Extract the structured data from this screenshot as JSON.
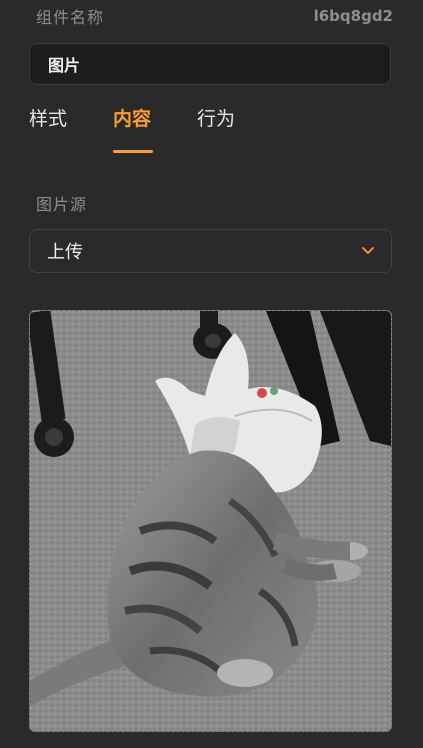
{
  "header": {
    "label": "组件名称",
    "component_id": "l6bq8gd2"
  },
  "name_field": {
    "value": "图片"
  },
  "tabs": [
    {
      "label": "样式",
      "active": false
    },
    {
      "label": "内容",
      "active": true
    },
    {
      "label": "行为",
      "active": false
    }
  ],
  "image_source": {
    "label": "图片源",
    "selected": "上传",
    "icon": "chevron-down-icon"
  },
  "preview": {
    "icon": "image-preview"
  },
  "colors": {
    "accent": "#ff9d2e",
    "background": "#2a2a2b",
    "input_bg": "#1d1d1e"
  }
}
